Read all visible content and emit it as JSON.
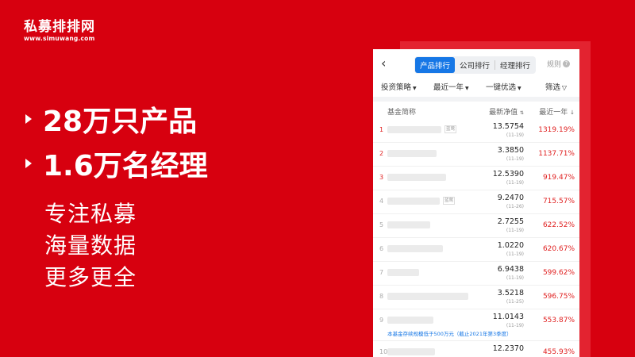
{
  "brand": {
    "name": "私募排排网",
    "url": "www.simuwang.com"
  },
  "headline": {
    "line1": "28万只产品",
    "line2": "1.6万名经理"
  },
  "subtext": [
    "专注私募",
    "海量数据",
    "更多更全"
  ],
  "app": {
    "back_icon": "chevron-left-icon",
    "tabs": [
      {
        "label": "产品排行",
        "active": true
      },
      {
        "label": "公司排行",
        "active": false
      },
      {
        "label": "经理排行",
        "active": false
      }
    ],
    "rules_label": "规则",
    "filters": [
      {
        "label": "投资策略"
      },
      {
        "label": "最近一年"
      },
      {
        "label": "一键优选"
      },
      {
        "label": "筛选"
      }
    ],
    "columns": {
      "name": "基金简称",
      "nav": "最新净值",
      "ret": "最近一年"
    },
    "rows": [
      {
        "rank": "1",
        "nav": "13.5754",
        "date": "(11-19)",
        "ret": "1319.19%",
        "tag": "蓝莺"
      },
      {
        "rank": "2",
        "nav": "3.3850",
        "date": "(11-19)",
        "ret": "1137.71%"
      },
      {
        "rank": "3",
        "nav": "12.5390",
        "date": "(11-19)",
        "ret": "919.47%"
      },
      {
        "rank": "4",
        "nav": "9.2470",
        "date": "(11-26)",
        "ret": "715.57%",
        "tag": "蓝莺"
      },
      {
        "rank": "5",
        "nav": "2.7255",
        "date": "(11-19)",
        "ret": "622.52%"
      },
      {
        "rank": "6",
        "nav": "1.0220",
        "date": "(11-19)",
        "ret": "620.67%"
      },
      {
        "rank": "7",
        "nav": "6.9438",
        "date": "(11-19)",
        "ret": "599.62%"
      },
      {
        "rank": "8",
        "nav": "3.5218",
        "date": "(11-25)",
        "ret": "596.75%"
      },
      {
        "rank": "9",
        "nav": "11.0143",
        "date": "(11-19)",
        "ret": "553.87%",
        "note": "本基金存续规模低于500万元（截止2021年第3季度）"
      },
      {
        "rank": "10",
        "nav": "12.2370",
        "date": "",
        "ret": "455.93%"
      }
    ]
  }
}
